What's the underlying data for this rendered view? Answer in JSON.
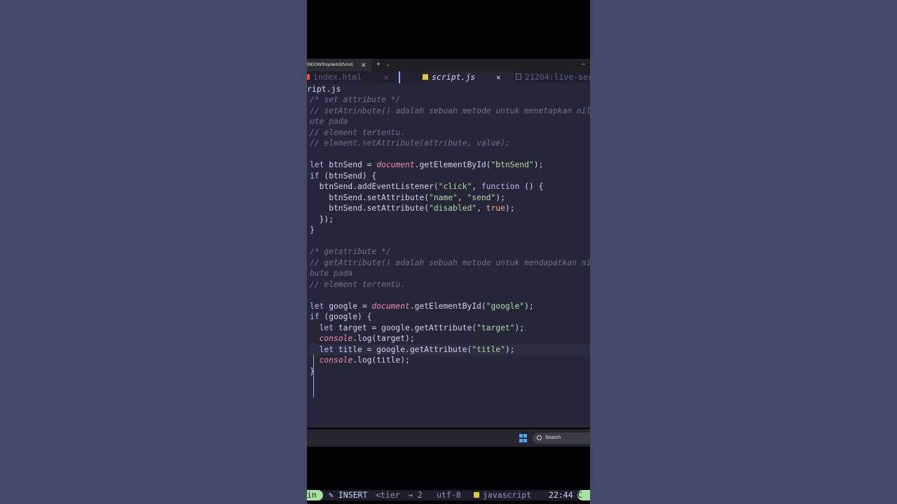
{
  "terminal": {
    "tab_title": "INDOWS\\system32\\cmd.",
    "close_glyph": "✕",
    "new_tab_glyph": "+",
    "dropdown_glyph": "⌄",
    "minimize_glyph": "–"
  },
  "buffers": [
    {
      "name": "index.html",
      "icon": "html-icon"
    },
    {
      "name": "script.js",
      "icon": "js-icon"
    },
    {
      "name": "21204:live-ser",
      "icon": "file-icon"
    }
  ],
  "winbar": "ript.js",
  "code_lines": [
    {
      "segs": [
        {
          "t": "/* set attribute */",
          "c": "comment"
        }
      ]
    },
    {
      "segs": [
        {
          "t": "// setAtrinbute() adalah sebuah metode untuk menetapkan nila",
          "c": "comment"
        }
      ]
    },
    {
      "segs": [
        {
          "t": "ute pada",
          "c": "comment"
        }
      ]
    },
    {
      "segs": [
        {
          "t": "// element tertentu.",
          "c": "comment"
        }
      ]
    },
    {
      "segs": [
        {
          "t": "// element.setAttribute(attribute, value);",
          "c": "comment"
        }
      ]
    },
    {
      "segs": []
    },
    {
      "segs": [
        {
          "t": "let",
          "c": "kw"
        },
        {
          "t": " btnSend = ",
          "c": "fn"
        },
        {
          "t": "document",
          "c": "doc"
        },
        {
          "t": ".getElementById(",
          "c": "fn"
        },
        {
          "t": "\"btnSend\"",
          "c": "str"
        },
        {
          "t": ");",
          "c": "fn"
        }
      ]
    },
    {
      "segs": [
        {
          "t": "if",
          "c": "kw"
        },
        {
          "t": " (btnSend) {",
          "c": "fn"
        }
      ]
    },
    {
      "segs": [
        {
          "t": "  btnSend.addEventListener(",
          "c": "fn"
        },
        {
          "t": "\"click\"",
          "c": "str"
        },
        {
          "t": ", ",
          "c": "fn"
        },
        {
          "t": "function",
          "c": "kw"
        },
        {
          "t": " () {",
          "c": "fn"
        }
      ]
    },
    {
      "segs": [
        {
          "t": "    btnSend.setAttribute(",
          "c": "fn"
        },
        {
          "t": "\"name\"",
          "c": "str"
        },
        {
          "t": ", ",
          "c": "fn"
        },
        {
          "t": "\"send\"",
          "c": "str"
        },
        {
          "t": ");",
          "c": "fn"
        }
      ]
    },
    {
      "segs": [
        {
          "t": "    btnSend.setAttribute(",
          "c": "fn"
        },
        {
          "t": "\"disabled\"",
          "c": "str"
        },
        {
          "t": ", ",
          "c": "fn"
        },
        {
          "t": "true",
          "c": "bool"
        },
        {
          "t": ");",
          "c": "fn"
        }
      ]
    },
    {
      "segs": [
        {
          "t": "  });",
          "c": "fn"
        }
      ]
    },
    {
      "segs": [
        {
          "t": "}",
          "c": "fn"
        }
      ]
    },
    {
      "segs": []
    },
    {
      "segs": [
        {
          "t": "/* getatribute */",
          "c": "comment"
        }
      ]
    },
    {
      "segs": [
        {
          "t": "// getAttribute() adalah sebuah metode untuk mendapatkan nil",
          "c": "comment"
        }
      ]
    },
    {
      "segs": [
        {
          "t": "bute pada",
          "c": "comment"
        }
      ]
    },
    {
      "segs": [
        {
          "t": "// element tertentu.",
          "c": "comment"
        }
      ]
    },
    {
      "segs": []
    },
    {
      "segs": [
        {
          "t": "let",
          "c": "kw"
        },
        {
          "t": " google = ",
          "c": "fn"
        },
        {
          "t": "document",
          "c": "doc"
        },
        {
          "t": ".getElementById(",
          "c": "fn"
        },
        {
          "t": "\"google\"",
          "c": "str"
        },
        {
          "t": ");",
          "c": "fn"
        }
      ]
    },
    {
      "segs": [
        {
          "t": "if",
          "c": "kw"
        },
        {
          "t": " (google) {",
          "c": "fn"
        }
      ]
    },
    {
      "segs": [
        {
          "t": "  ",
          "c": "fn"
        },
        {
          "t": "let",
          "c": "kw"
        },
        {
          "t": " target = google.getAttribute(",
          "c": "fn"
        },
        {
          "t": "\"target\"",
          "c": "str"
        },
        {
          "t": ");",
          "c": "fn"
        }
      ]
    },
    {
      "segs": [
        {
          "t": "  ",
          "c": "fn"
        },
        {
          "t": "console",
          "c": "doc"
        },
        {
          "t": ".log(target);",
          "c": "fn"
        }
      ]
    },
    {
      "segs": [
        {
          "t": "  ",
          "c": "fn"
        },
        {
          "t": "let",
          "c": "kw"
        },
        {
          "t": " title = google.getAttribute(",
          "c": "fn"
        },
        {
          "t": "\"title\"",
          "c": "str"
        },
        {
          "t": ");",
          "c": "fn"
        }
      ],
      "cursor": true
    },
    {
      "segs": [
        {
          "t": "  ",
          "c": "fn"
        },
        {
          "t": "console",
          "c": "doc"
        },
        {
          "t": ".log(title);",
          "c": "fn"
        }
      ]
    },
    {
      "segs": [
        {
          "t": "}",
          "c": "fn"
        }
      ]
    }
  ],
  "statusline": {
    "mode_left": "in",
    "mode": "INSERT",
    "branch": "<tier",
    "indent": "⇥ 2",
    "encoding": "utf-8",
    "filetype": "javascript",
    "time": "22:44",
    "end": "C"
  },
  "taskbar": {
    "search_label": "Search"
  },
  "colors": {
    "comment": "#6c7293",
    "keyword": "#b4befe",
    "builtin": "#f38ba8",
    "string": "#a6e3a1",
    "boolean": "#fab387",
    "accent": "#89b4fa",
    "mode_bg": "#a6e3a1"
  }
}
